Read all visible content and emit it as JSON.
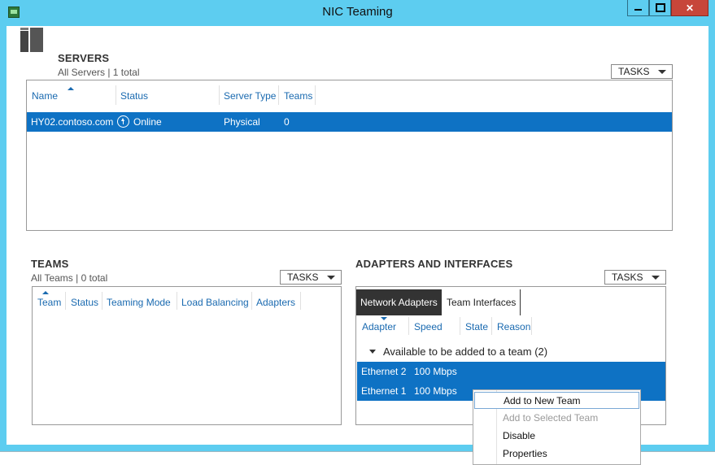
{
  "window": {
    "title": "NIC Teaming",
    "controls": {
      "minimize": "",
      "maximize": "",
      "close": "✕"
    }
  },
  "servers": {
    "title": "SERVERS",
    "subtitle": "All Servers | 1 total",
    "tasks_label": "TASKS",
    "columns": [
      "Name",
      "Status",
      "Server Type",
      "Teams"
    ],
    "rows": [
      {
        "name": "HY02.contoso.com",
        "status": "Online",
        "server_type": "Physical",
        "teams": "0"
      }
    ]
  },
  "teams": {
    "title": "TEAMS",
    "subtitle": "All Teams | 0 total",
    "tasks_label": "TASKS",
    "columns": [
      "Team",
      "Status",
      "Teaming Mode",
      "Load Balancing",
      "Adapters"
    ]
  },
  "adapters": {
    "title": "ADAPTERS AND INTERFACES",
    "tasks_label": "TASKS",
    "tabs": [
      "Network Adapters",
      "Team Interfaces"
    ],
    "columns": [
      "Adapter",
      "Speed",
      "State",
      "Reason"
    ],
    "group_label": "Available to be added to a team (2)",
    "rows": [
      {
        "adapter": "Ethernet 2",
        "speed": "100 Mbps"
      },
      {
        "adapter": "Ethernet 1",
        "speed": "100 Mbps"
      }
    ]
  },
  "context_menu": {
    "items": [
      "Add to New Team",
      "Add to Selected Team",
      "Disable",
      "Properties"
    ]
  },
  "colors": {
    "title_bar": "#5dcdf0",
    "selection": "#0e72c4",
    "close_button": "#c7463a",
    "link_header": "#1a6ab0"
  }
}
